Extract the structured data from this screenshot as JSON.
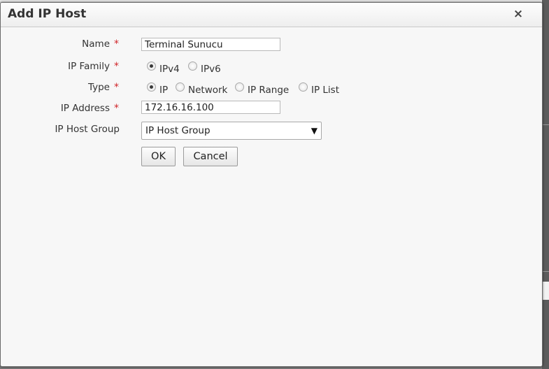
{
  "dialog": {
    "title": "Add IP Host",
    "close_glyph": "×"
  },
  "form": {
    "required_mark": "*",
    "name": {
      "label": "Name",
      "value": "Terminal Sunucu"
    },
    "ip_family": {
      "label": "IP Family",
      "options": [
        "IPv4",
        "IPv6"
      ],
      "selected": "IPv4"
    },
    "type": {
      "label": "Type",
      "options": [
        "IP",
        "Network",
        "IP Range",
        "IP List"
      ],
      "selected": "IP"
    },
    "ip_address": {
      "label": "IP Address",
      "value": "172.16.16.100"
    },
    "ip_host_group": {
      "label": "IP Host Group",
      "selected": "IP Host Group"
    }
  },
  "buttons": {
    "ok_label": "OK",
    "cancel_label": "Cancel"
  },
  "icons": {
    "close": "close-icon",
    "dropdown": "caret-down-icon",
    "dropdown_glyph": "▼"
  }
}
